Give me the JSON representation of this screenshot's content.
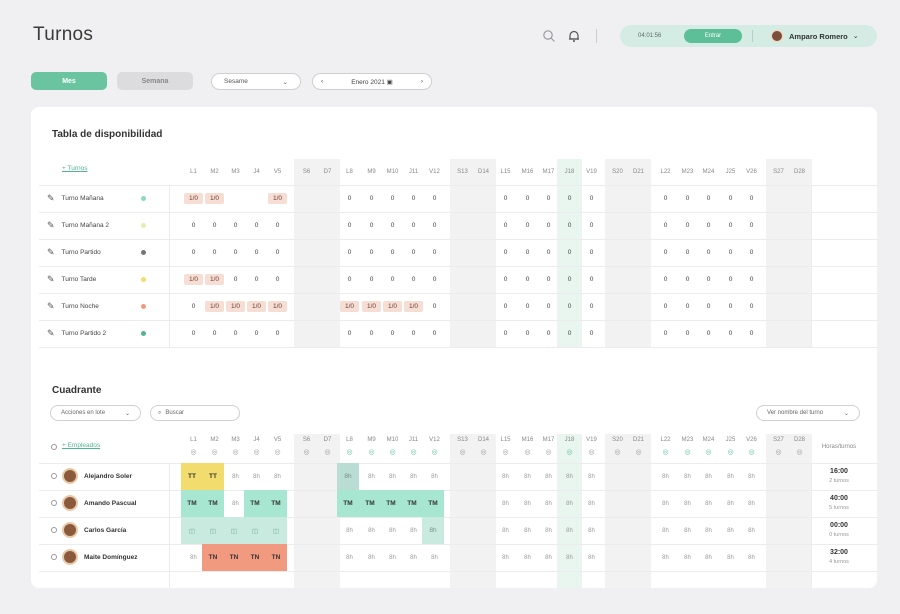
{
  "header": {
    "title": "Turnos",
    "clock": "04:01:56",
    "enter_label": "Entrar",
    "user_name": "Amparo Romero"
  },
  "toolbar": {
    "view_month": "Mes",
    "view_week": "Semana",
    "company_select": "Sesame",
    "month_label": "Enero 2021"
  },
  "availability": {
    "title": "Tabla de disponibilidad",
    "add_label": "+ Turnos",
    "days": [
      "L1",
      "M2",
      "M3",
      "J4",
      "V5",
      "S6",
      "D7",
      "L8",
      "M9",
      "M10",
      "J11",
      "V12",
      "S13",
      "D14",
      "L15",
      "M16",
      "M17",
      "J18",
      "V19",
      "S20",
      "D21",
      "L22",
      "M23",
      "M24",
      "J25",
      "V26",
      "S27",
      "D28"
    ],
    "rows": [
      {
        "name": "Turno Mañana",
        "color": "#8fd8c1",
        "values": [
          "1/0",
          "1/0",
          "",
          "",
          "1/0",
          "",
          "",
          "0",
          "0",
          "0",
          "0",
          "0",
          "",
          "",
          "0",
          "0",
          "0",
          "0",
          "0",
          "",
          "",
          "0",
          "0",
          "0",
          "0",
          "0",
          "",
          ""
        ]
      },
      {
        "name": "Turno Mañana 2",
        "color": "#e6ecb5",
        "values": [
          "0",
          "0",
          "0",
          "0",
          "0",
          "",
          "",
          "0",
          "0",
          "0",
          "0",
          "0",
          "",
          "",
          "0",
          "0",
          "0",
          "0",
          "0",
          "",
          "",
          "0",
          "0",
          "0",
          "0",
          "0",
          "",
          ""
        ]
      },
      {
        "name": "Turno Partido",
        "color": "#777777",
        "values": [
          "0",
          "0",
          "0",
          "0",
          "0",
          "",
          "",
          "0",
          "0",
          "0",
          "0",
          "0",
          "",
          "",
          "0",
          "0",
          "0",
          "0",
          "0",
          "",
          "",
          "0",
          "0",
          "0",
          "0",
          "0",
          "",
          ""
        ]
      },
      {
        "name": "Turno Tarde",
        "color": "#f2dc6d",
        "values": [
          "1/0",
          "1/0",
          "0",
          "0",
          "0",
          "",
          "",
          "0",
          "0",
          "0",
          "0",
          "0",
          "",
          "",
          "0",
          "0",
          "0",
          "0",
          "0",
          "",
          "",
          "0",
          "0",
          "0",
          "0",
          "0",
          "",
          ""
        ]
      },
      {
        "name": "Turno Noche",
        "color": "#f29a80",
        "values": [
          "0",
          "1/0",
          "1/0",
          "1/0",
          "1/0",
          "",
          "",
          "1/0",
          "1/0",
          "1/0",
          "1/0",
          "0",
          "",
          "",
          "0",
          "0",
          "0",
          "0",
          "0",
          "",
          "",
          "0",
          "0",
          "0",
          "0",
          "0",
          "",
          ""
        ]
      },
      {
        "name": "Turno Partido 2",
        "color": "#4fb58e",
        "values": [
          "0",
          "0",
          "0",
          "0",
          "0",
          "",
          "",
          "0",
          "0",
          "0",
          "0",
          "0",
          "",
          "",
          "0",
          "0",
          "0",
          "0",
          "0",
          "",
          "",
          "0",
          "0",
          "0",
          "0",
          "0",
          "",
          ""
        ]
      }
    ]
  },
  "roster": {
    "title": "Cuadrante",
    "bulk_label": "Acciones en lote",
    "search_placeholder": "Buscar",
    "view_label": "Ver nombre del turno",
    "add_label": "+ Empleados",
    "hours_header": "Horas/turnos",
    "employees": [
      {
        "name": "Alejandro Soler",
        "hours": "16:00",
        "shifts": "2 turnos"
      },
      {
        "name": "Amando Pascual",
        "hours": "40:00",
        "shifts": "5 turnos"
      },
      {
        "name": "Carlos García",
        "hours": "00:00",
        "shifts": "0 turnos"
      },
      {
        "name": "Maite Domínguez",
        "hours": "32:00",
        "shifts": "4 turnos"
      }
    ],
    "cells": [
      [
        "TT",
        "TT",
        "8h",
        "8h",
        "8h",
        "",
        "",
        "8h",
        "8h",
        "8h",
        "8h",
        "8h",
        "",
        "",
        "8h",
        "8h",
        "8h",
        "8h",
        "8h",
        "",
        "",
        "8h",
        "8h",
        "8h",
        "8h",
        "8h",
        "",
        ""
      ],
      [
        "TM",
        "TM",
        "8h",
        "TM",
        "TM",
        "",
        "",
        "TM",
        "TM",
        "TM",
        "TM",
        "TM",
        "",
        "",
        "8h",
        "8h",
        "8h",
        "8h",
        "8h",
        "",
        "",
        "8h",
        "8h",
        "8h",
        "8h",
        "8h",
        "",
        ""
      ],
      [
        "◫",
        "◫",
        "◫",
        "◫",
        "◫",
        "",
        "",
        "8h",
        "8h",
        "8h",
        "8h",
        "8h",
        "",
        "",
        "8h",
        "8h",
        "8h",
        "8h",
        "8h",
        "",
        "",
        "8h",
        "8h",
        "8h",
        "8h",
        "8h",
        "",
        ""
      ],
      [
        "8h",
        "TN",
        "TN",
        "TN",
        "TN",
        "",
        "",
        "8h",
        "8h",
        "8h",
        "8h",
        "8h",
        "",
        "",
        "8h",
        "8h",
        "8h",
        "8h",
        "8h",
        "",
        "",
        "8h",
        "8h",
        "8h",
        "8h",
        "8h",
        "",
        ""
      ]
    ]
  },
  "icons": {
    "search": "search-icon",
    "bell": "bell-icon",
    "calendar": "calendar-icon",
    "pencil": "pencil-icon",
    "eye": "eye-icon"
  },
  "colors": {
    "accent": "#5dbf97",
    "tt": "#f2dc6d",
    "tm": "#a7e6d1",
    "tn": "#f29a80",
    "tn_first": "#f7ded5",
    "cg": "#c9eadf",
    "m8": "#c9eadf"
  }
}
